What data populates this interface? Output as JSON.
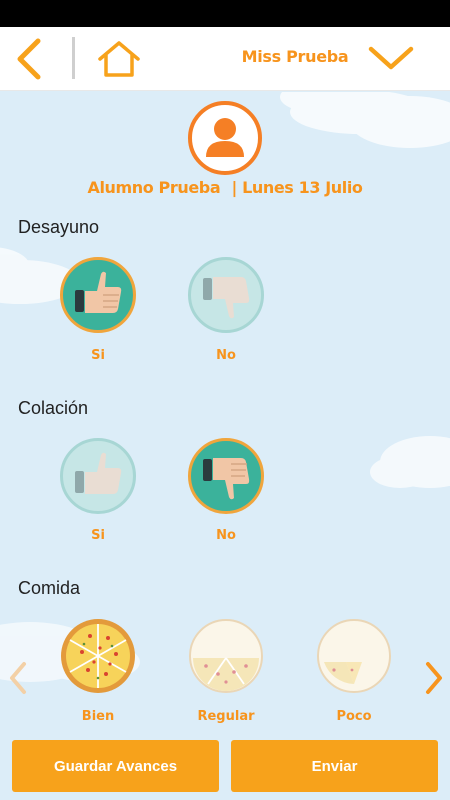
{
  "header": {
    "teacher_name": "Miss Prueba",
    "back_icon": "chevron-left-icon",
    "home_icon": "home-icon",
    "dropdown_icon": "chevron-down-icon"
  },
  "student": {
    "name": "Alumno Prueba",
    "date": "Lunes 13 Julio",
    "separator": "|",
    "avatar_icon": "user-icon"
  },
  "sections": {
    "breakfast": {
      "title": "Desayuno",
      "options": [
        {
          "label": "Si",
          "selected": true,
          "icon": "thumbs-up-icon"
        },
        {
          "label": "No",
          "selected": false,
          "icon": "thumbs-down-icon"
        }
      ]
    },
    "snack": {
      "title": "Colación",
      "options": [
        {
          "label": "Si",
          "selected": false,
          "icon": "thumbs-up-icon"
        },
        {
          "label": "No",
          "selected": true,
          "icon": "thumbs-down-icon"
        }
      ]
    },
    "meal": {
      "title": "Comida",
      "options": [
        {
          "label": "Bien",
          "selected": true,
          "icon": "pizza-full-icon"
        },
        {
          "label": "Regular",
          "selected": false,
          "icon": "pizza-half-icon"
        },
        {
          "label": "Poco",
          "selected": false,
          "icon": "pizza-slice-icon"
        }
      ]
    }
  },
  "actions": {
    "save_label": "Guardar Avances",
    "send_label": "Enviar"
  },
  "colors": {
    "accent": "#f7941d",
    "button": "#f7a21b",
    "selected": "#3bb29b",
    "background": "#dcedf8"
  }
}
